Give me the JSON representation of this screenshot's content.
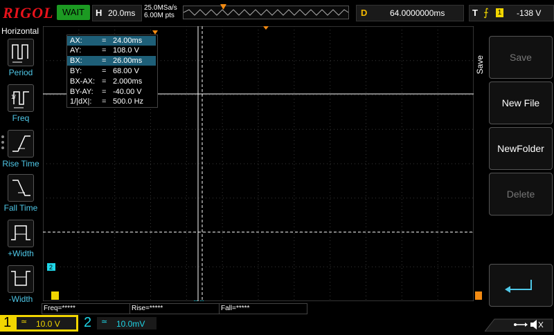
{
  "top": {
    "logo": "RIGOL",
    "run_status": "WAIT",
    "horizontal_key": "H",
    "timebase": "20.0ms",
    "sample_rate": "25.0MSa/s",
    "mem_depth": "6.00M pts",
    "delay_key": "D",
    "delay": "64.0000000ms",
    "trigger_key": "T",
    "trigger_source": "1",
    "trigger_level": "-138 V"
  },
  "left_menu": {
    "title": "Horizontal",
    "items": [
      {
        "label": "Period"
      },
      {
        "label": "Freq"
      },
      {
        "label": "Rise Time"
      },
      {
        "label": "Fall Time"
      },
      {
        "label": "+Width"
      },
      {
        "label": "-Width"
      }
    ]
  },
  "measurements": {
    "rows": [
      {
        "label": "AX:",
        "value": "24.00ms"
      },
      {
        "label": "AY:",
        "value": "108.0 V"
      },
      {
        "label": "BX:",
        "value": "26.00ms"
      },
      {
        "label": "BY:",
        "value": "68.00 V"
      },
      {
        "label": "BX-AX:",
        "value": "2.000ms"
      },
      {
        "label": "BY-AY:",
        "value": "-40.00 V"
      },
      {
        "label": "1/|dX|:",
        "value": "500.0 Hz"
      }
    ],
    "equals": "="
  },
  "markers": {
    "ch2_marker": "2"
  },
  "bottom": {
    "freq": "Freq=*****",
    "rise": "Rise=*****",
    "fall": "Fall=*****",
    "ch1_number": "1",
    "ch1_coupling": "≃",
    "ch1_scale": "10.0 V",
    "ch2_number": "2",
    "ch2_coupling": "≃",
    "ch2_scale": "10.0mV"
  },
  "right_menu": {
    "title": "Save",
    "buttons": [
      {
        "label": "Save",
        "enabled": false
      },
      {
        "label": "New File",
        "enabled": true
      },
      {
        "label": "NewFolder",
        "enabled": true
      },
      {
        "label": "Delete",
        "enabled": false
      }
    ]
  },
  "colors": {
    "ch1": "#f2d600",
    "ch2": "#1fd6e8",
    "run_status_bg": "#1c9a22",
    "logo": "#e8121b",
    "trigger_marker": "#f28a12"
  }
}
